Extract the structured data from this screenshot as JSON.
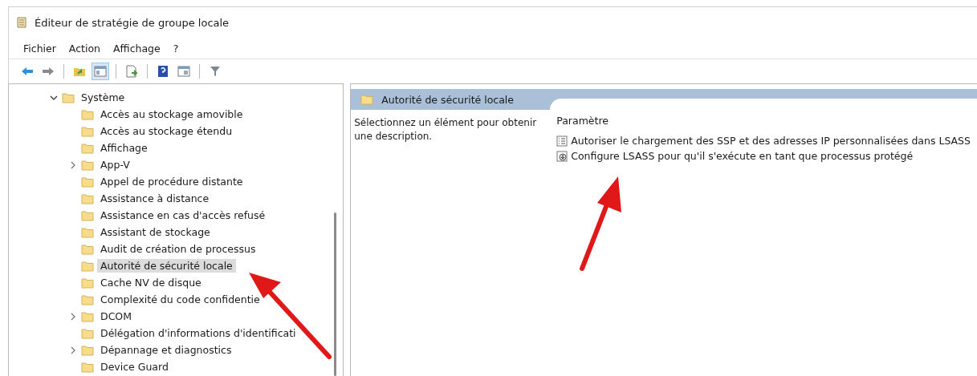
{
  "window": {
    "title": "Éditeur de stratégie de groupe locale"
  },
  "menu": [
    "Fichier",
    "Action",
    "Affichage",
    "?"
  ],
  "toolbar": [
    {
      "kind": "back",
      "pressed": false
    },
    {
      "kind": "forward",
      "pressed": false
    },
    {
      "kind": "sep"
    },
    {
      "kind": "up",
      "pressed": false
    },
    {
      "kind": "tree",
      "pressed": true
    },
    {
      "kind": "sep"
    },
    {
      "kind": "export",
      "pressed": false
    },
    {
      "kind": "sep"
    },
    {
      "kind": "help",
      "pressed": false
    },
    {
      "kind": "view",
      "pressed": false
    },
    {
      "kind": "sep"
    },
    {
      "kind": "filter",
      "pressed": false
    }
  ],
  "tree": {
    "label": "Système",
    "expanded": true,
    "children": [
      {
        "label": "Accès au stockage amovible",
        "selected": false,
        "has_children": false
      },
      {
        "label": "Accès au stockage étendu",
        "selected": false,
        "has_children": false
      },
      {
        "label": "Affichage",
        "selected": false,
        "has_children": false
      },
      {
        "label": "App-V",
        "selected": false,
        "has_children": true
      },
      {
        "label": "Appel de procédure distante",
        "selected": false,
        "has_children": false
      },
      {
        "label": "Assistance à distance",
        "selected": false,
        "has_children": false
      },
      {
        "label": "Assistance en cas d'accès refusé",
        "selected": false,
        "has_children": false
      },
      {
        "label": "Assistant de stockage",
        "selected": false,
        "has_children": false
      },
      {
        "label": "Audit de création de processus",
        "selected": false,
        "has_children": false
      },
      {
        "label": "Autorité de sécurité locale",
        "selected": true,
        "has_children": false
      },
      {
        "label": "Cache NV de disque",
        "selected": false,
        "has_children": false
      },
      {
        "label": "Complexité du code confidentie",
        "selected": false,
        "has_children": false
      },
      {
        "label": "DCOM",
        "selected": false,
        "has_children": true
      },
      {
        "label": "Délégation d'informations d'identificati",
        "selected": false,
        "has_children": false
      },
      {
        "label": "Dépannage et diagnostics",
        "selected": false,
        "has_children": true
      },
      {
        "label": "Device Guard",
        "selected": false,
        "has_children": false
      }
    ]
  },
  "details": {
    "header": "Autorité de sécurité locale",
    "description": "Sélectionnez un élément pour obtenir une description.",
    "column": "Paramètre",
    "settings": [
      {
        "kind": "list",
        "label": "Autoriser le chargement des SSP et des adresses IP personnalisées dans LSASS"
      },
      {
        "kind": "download",
        "label": "Configure LSASS pour qu'il s'exécute en tant que processus protégé"
      }
    ]
  }
}
